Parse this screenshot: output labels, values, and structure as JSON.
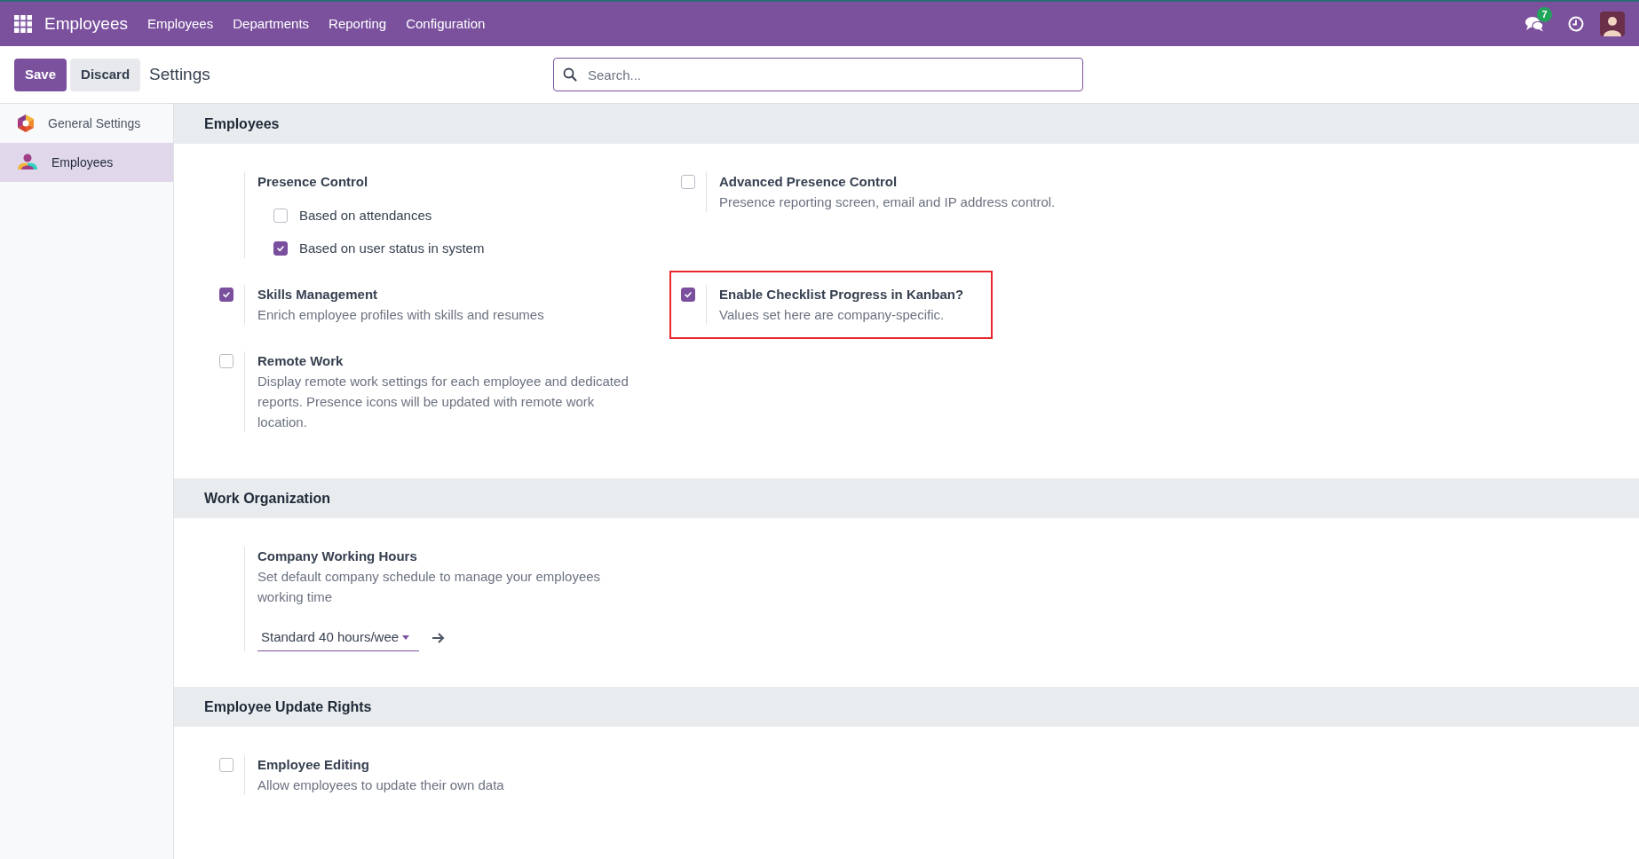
{
  "navbar": {
    "app_title": "Employees",
    "menu": [
      "Employees",
      "Departments",
      "Reporting",
      "Configuration"
    ],
    "message_count": "7"
  },
  "control_panel": {
    "buttons": [
      "Save",
      "Discard"
    ],
    "title": "Settings",
    "search": {
      "placeholder": "Search..."
    }
  },
  "sidebar": {
    "items": [
      {
        "label": "General Settings",
        "selected": false
      },
      {
        "label": "Employees",
        "selected": true
      }
    ]
  },
  "sections": [
    {
      "title": "Employees",
      "settings": [
        {
          "kind": "group",
          "title": "Presence Control",
          "options": [
            {
              "label": "Based on attendances",
              "checked": false
            },
            {
              "label": "Based on user status in system",
              "checked": true
            }
          ]
        },
        {
          "kind": "checkbox",
          "title": "Advanced Presence Control",
          "description": "Presence reporting screen, email and IP address control.",
          "checked": false,
          "highlighted": false
        },
        {
          "kind": "checkbox",
          "title": "Skills Management",
          "description": "Enrich employee profiles with skills and resumes",
          "checked": true,
          "highlighted": false
        },
        {
          "kind": "checkbox",
          "title": "Enable Checklist Progress in Kanban?",
          "description": "Values set here are company-specific.",
          "checked": true,
          "highlighted": true
        },
        {
          "kind": "checkbox",
          "title": "Remote Work",
          "description": "Display remote work settings for each employee and dedicated reports. Presence icons will be updated with remote work location.",
          "checked": false,
          "highlighted": false
        }
      ]
    },
    {
      "title": "Work Organization",
      "settings": [
        {
          "kind": "select",
          "title": "Company Working Hours",
          "description": "Set default company schedule to manage your employees working time",
          "value": "Standard 40 hours/wee"
        }
      ]
    },
    {
      "title": "Employee Update Rights",
      "settings": [
        {
          "kind": "checkbox",
          "title": "Employee Editing",
          "description": "Allow employees to update their own data",
          "checked": false,
          "highlighted": false
        }
      ]
    }
  ]
}
